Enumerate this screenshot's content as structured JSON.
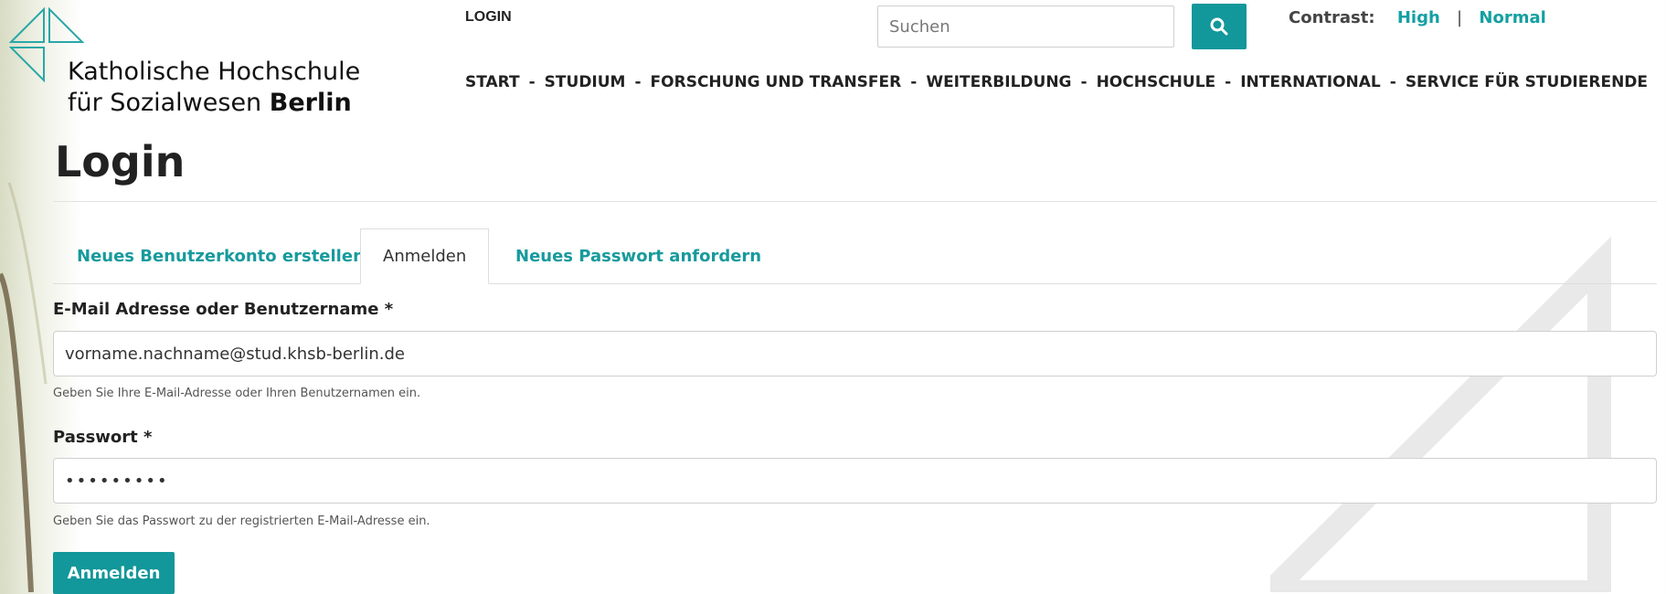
{
  "header": {
    "logo_line1": "Katholische Hochschule",
    "logo_line2_prefix": "für Sozialwesen ",
    "logo_line2_bold": "Berlin",
    "login_link": "LOGIN",
    "search_placeholder": "Suchen",
    "search_icon": "search-icon",
    "contrast_label": "Contrast:",
    "contrast_high": "High",
    "contrast_separator": "|",
    "contrast_normal": "Normal"
  },
  "nav": {
    "items": [
      "START",
      "STUDIUM",
      "FORSCHUNG UND TRANSFER",
      "WEITERBILDUNG",
      "HOCHSCHULE",
      "INTERNATIONAL",
      "SERVICE FÜR STUDIERENDE"
    ],
    "separator": "-"
  },
  "main": {
    "title": "Login",
    "tabs": [
      {
        "label": "Neues Benutzerkonto erstellen",
        "active": false
      },
      {
        "label": "Anmelden",
        "active": true
      },
      {
        "label": "Neues Passwort anfordern",
        "active": false
      }
    ],
    "form": {
      "username_label": "E-Mail Adresse oder Benutzername *",
      "username_value": "vorname.nachname@stud.khsb-berlin.de",
      "username_help": "Geben Sie Ihre E-Mail-Adresse oder Ihren Benutzernamen ein.",
      "password_label": "Passwort *",
      "password_value": "•••••••••",
      "password_help": "Geben Sie das Passwort zu der registrierten E-Mail-Adresse ein.",
      "submit_label": "Anmelden"
    }
  },
  "colors": {
    "accent": "#12979a",
    "link": "#14a0a2",
    "text": "#222222"
  }
}
